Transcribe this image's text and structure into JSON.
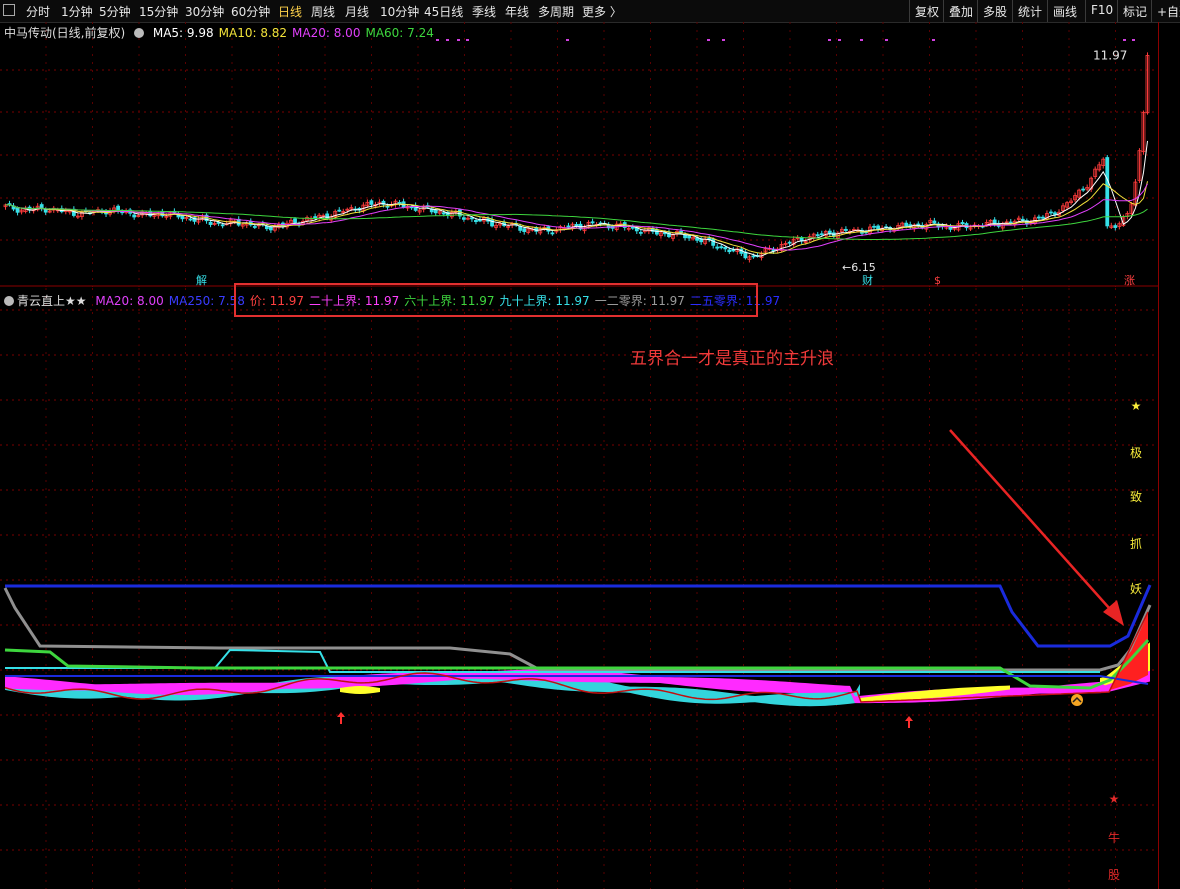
{
  "toolbar": {
    "tabs": [
      "分时",
      "1分钟",
      "5分钟",
      "15分钟",
      "30分钟",
      "60分钟",
      "日线",
      "周线",
      "月线",
      "10分钟",
      "45日线",
      "季线",
      "年线",
      "多周期",
      "更多 〉"
    ],
    "active_tab": "日线",
    "right_buttons": [
      "复权",
      "叠加",
      "多股",
      "统计",
      "画线",
      "F10",
      "标记",
      "+自选"
    ]
  },
  "colors": {
    "up": "#ff3c3c",
    "down": "#36e0e8",
    "ma5": "#ffffff",
    "ma10": "#f2e23a",
    "ma20": "#e040fb",
    "ma60": "#3ed63e",
    "blue": "#1a2bdc",
    "gray": "#909090",
    "yellow": "#ffff2a",
    "magenta": "#ff2aff",
    "red": "#ff2020",
    "green": "#3ed63e",
    "cyan": "#36e0e8"
  },
  "top_chart": {
    "title": "中马传动(日线,前复权)",
    "legend": [
      {
        "label": "MA5: 9.98",
        "color": "#ffffff"
      },
      {
        "label": "MA10: 8.82",
        "color": "#f2e23a"
      },
      {
        "label": "MA20: 8.00",
        "color": "#e040fb"
      },
      {
        "label": "MA60: 7.24",
        "color": "#3ed63e"
      }
    ],
    "high_label": "11.97",
    "low_label": "6.15",
    "markers": {
      "jie": "解",
      "cai": "财",
      "dollar": "$",
      "xingzhang": "涨"
    }
  },
  "bottom_chart": {
    "title": "青云直上★★",
    "legend": [
      {
        "label": "MA20: 8.00",
        "color": "#e040fb"
      },
      {
        "label": "MA250: 7.58",
        "color": "#3a3cff"
      },
      {
        "label": "价: 11.97",
        "color": "#ff4040"
      },
      {
        "label": "二十上界: 11.97",
        "color": "#ff40ff"
      },
      {
        "label": "六十上界: 11.97",
        "color": "#3ed63e"
      },
      {
        "label": "九十上界: 11.97",
        "color": "#36e0e8"
      },
      {
        "label": "一二零界: 11.97",
        "color": "#9a9a9a"
      },
      {
        "label": "二五零界: 11.97",
        "color": "#2a2cff"
      }
    ],
    "annotation": "五界合一才是真正的主升浪",
    "vertical_text_top": [
      "★",
      "极",
      "致",
      "抓",
      "妖"
    ],
    "vertical_text_bottom": [
      "★",
      "牛",
      "股"
    ]
  },
  "chart_data": [
    {
      "type": "candlestick",
      "title": "中马传动(日线,前复权)",
      "series": [
        {
          "name": "MA5",
          "last": 9.98
        },
        {
          "name": "MA10",
          "last": 8.82
        },
        {
          "name": "MA20",
          "last": 8.0
        },
        {
          "name": "MA60",
          "last": 7.24
        }
      ],
      "close": [
        7.6,
        7.5,
        7.55,
        7.45,
        7.4,
        7.5,
        7.45,
        7.35,
        7.4,
        7.3,
        7.2,
        7.1,
        7.15,
        7.0,
        7.05,
        7.2,
        7.3,
        7.45,
        7.6,
        7.7,
        7.65,
        7.55,
        7.45,
        7.35,
        7.2,
        7.1,
        7.0,
        6.9,
        6.95,
        7.05,
        7.1,
        7.05,
        6.95,
        6.85,
        6.8,
        6.7,
        6.5,
        6.3,
        6.15,
        6.4,
        6.6,
        6.75,
        6.85,
        6.9,
        6.95,
        7.0,
        7.05,
        7.1,
        7.0,
        7.05,
        7.1,
        7.15,
        7.2,
        7.35,
        7.7,
        8.3,
        9.2,
        10.4,
        11.97
      ],
      "low": 6.15,
      "high": 11.97,
      "ylim": [
        5.8,
        12.3
      ]
    },
    {
      "type": "line",
      "title": "青云直上★★",
      "series": [
        {
          "name": "MA20",
          "last": 8.0
        },
        {
          "name": "MA250",
          "last": 7.58
        },
        {
          "name": "价",
          "last": 11.97
        },
        {
          "name": "二十上界",
          "last": 11.97
        },
        {
          "name": "六十上界",
          "last": 11.97
        },
        {
          "name": "九十上界",
          "last": 11.97
        },
        {
          "name": "一二零界",
          "last": 11.97
        },
        {
          "name": "二五零界",
          "last": 11.97
        }
      ]
    }
  ]
}
